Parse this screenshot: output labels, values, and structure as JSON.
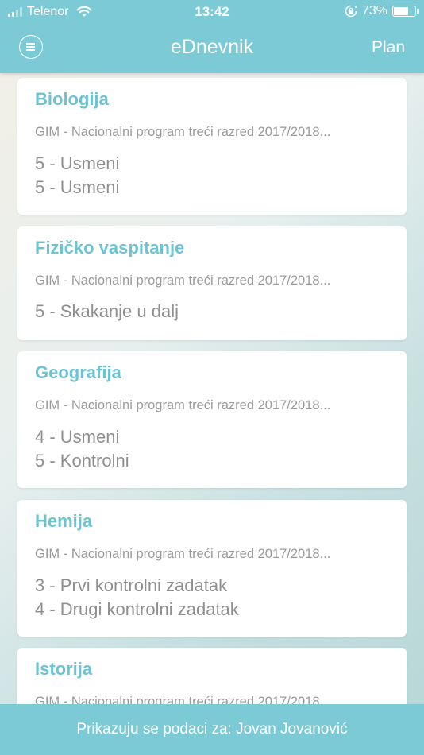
{
  "status_bar": {
    "carrier": "Telenor",
    "time": "13:42",
    "battery_percent": "73%",
    "battery_level": 0.73
  },
  "nav": {
    "title": "eDnevnik",
    "plan_label": "Plan",
    "menu_icon": "hamburger-menu-icon"
  },
  "cards": [
    {
      "subject": "Biologija",
      "program": "GIM - Nacionalni program treći razred 2017/2018...",
      "grades": [
        "5 - Usmeni",
        "5 - Usmeni"
      ]
    },
    {
      "subject": "Fizičko vaspitanje",
      "program": "GIM - Nacionalni program treći razred 2017/2018...",
      "grades": [
        "5 - Skakanje u dalj"
      ]
    },
    {
      "subject": "Geografija",
      "program": "GIM - Nacionalni program treći razred 2017/2018...",
      "grades": [
        "4 - Usmeni",
        "5 - Kontrolni"
      ]
    },
    {
      "subject": "Hemija",
      "program": "GIM - Nacionalni program treći razred 2017/2018...",
      "grades": [
        "3 - Prvi kontrolni zadatak",
        "4 - Drugi kontrolni zadatak"
      ]
    },
    {
      "subject": "Istorija",
      "program": "GIM - Nacionalni program treći razred 2017/2018...",
      "grades": []
    }
  ],
  "footer": {
    "text": "Prikazuju se podaci za: Jovan Jovanović"
  },
  "colors": {
    "accent": "#7ccad6",
    "subject": "#6cc3d2",
    "muted_text": "#9a9a9a"
  }
}
